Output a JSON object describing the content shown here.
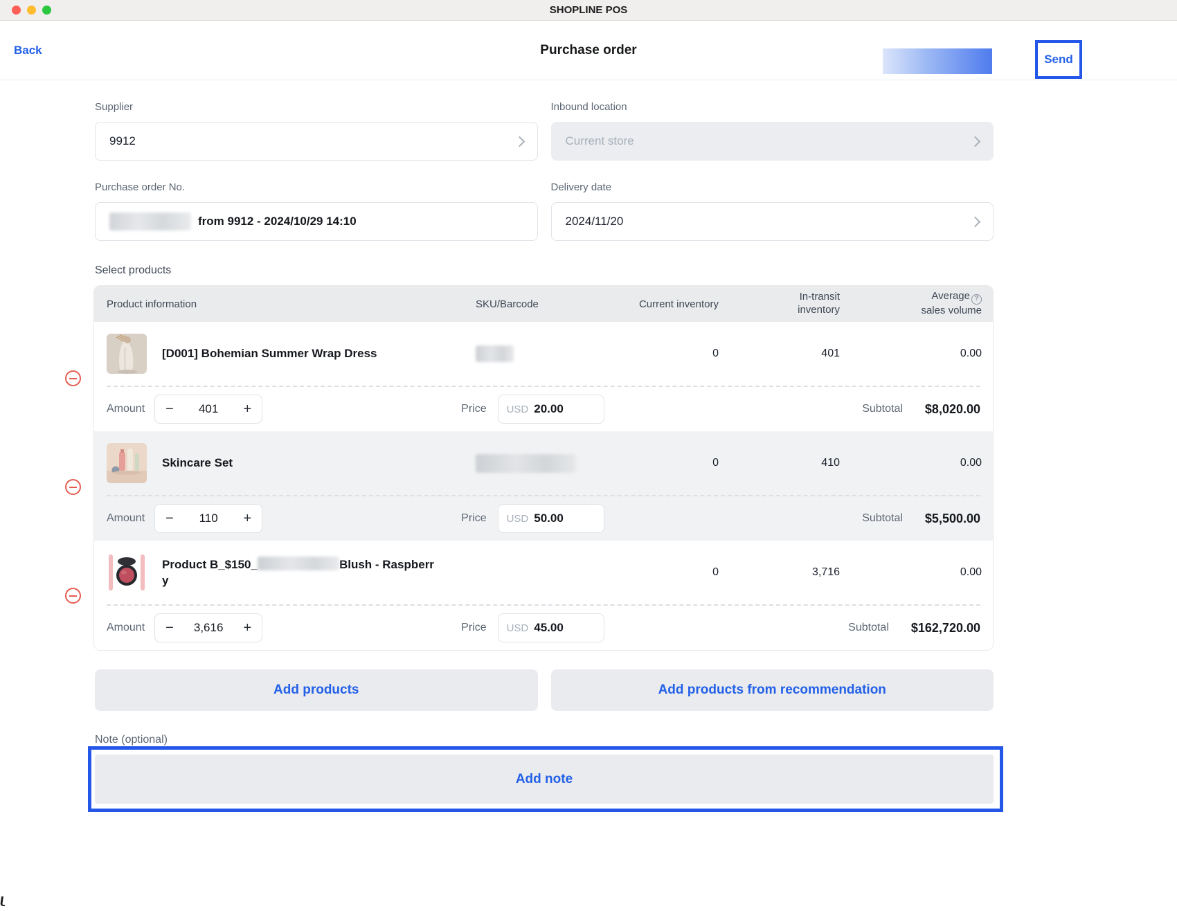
{
  "titlebar": {
    "app_title": "SHOPLINE POS"
  },
  "header": {
    "back": "Back",
    "title": "Purchase order",
    "send": "Send"
  },
  "form": {
    "supplier_label": "Supplier",
    "supplier_value": "9912",
    "inbound_label": "Inbound location",
    "inbound_value": "Current store",
    "po_label": "Purchase order No.",
    "po_value": "from 9912 - 2024/10/29 14:10",
    "delivery_label": "Delivery date",
    "delivery_value": "2024/11/20"
  },
  "products": {
    "section_title": "Select products",
    "headers": {
      "product": "Product information",
      "sku": "SKU/Barcode",
      "current": "Current inventory",
      "transit_line1": "In-transit",
      "transit_line2": "inventory",
      "avg_line1": "Average",
      "avg_line2": "sales volume",
      "help_glyph": "?"
    },
    "labels": {
      "amount": "Amount",
      "price": "Price",
      "subtotal": "Subtotal",
      "minus": "−",
      "plus": "+"
    },
    "rows": [
      {
        "name": "[D001] Bohemian Summer Wrap Dress",
        "current": "0",
        "transit": "401",
        "avg": "0.00",
        "amount": "401",
        "currency": "USD",
        "price": "20.00",
        "subtotal": "$8,020.00"
      },
      {
        "name": "Skincare Set",
        "current": "0",
        "transit": "410",
        "avg": "0.00",
        "amount": "110",
        "currency": "USD",
        "price": "50.00",
        "subtotal": "$5,500.00"
      },
      {
        "name_prefix": "Product B_$150_",
        "name_suffix": "Blush - Raspberr",
        "name_wrap": "y",
        "current": "0",
        "transit": "3,716",
        "avg": "0.00",
        "amount": "3,616",
        "currency": "USD",
        "price": "45.00",
        "subtotal": "$162,720.00"
      }
    ]
  },
  "actions": {
    "add_products": "Add products",
    "add_from_recommendation": "Add products from recommendation"
  },
  "note": {
    "label": "Note (optional)",
    "add_note": "Add note"
  },
  "colors": {
    "accent_blue": "#2360e8",
    "annotation_blue": "#2456e8",
    "danger_red": "#e65c50",
    "traffic_red": "#ff5f57",
    "traffic_yellow": "#febc2e",
    "traffic_green": "#2ac840",
    "disabled_bg": "#ebedf0",
    "table_header_bg": "#e9ebed",
    "row_alt_bg": "#f1f2f4"
  }
}
